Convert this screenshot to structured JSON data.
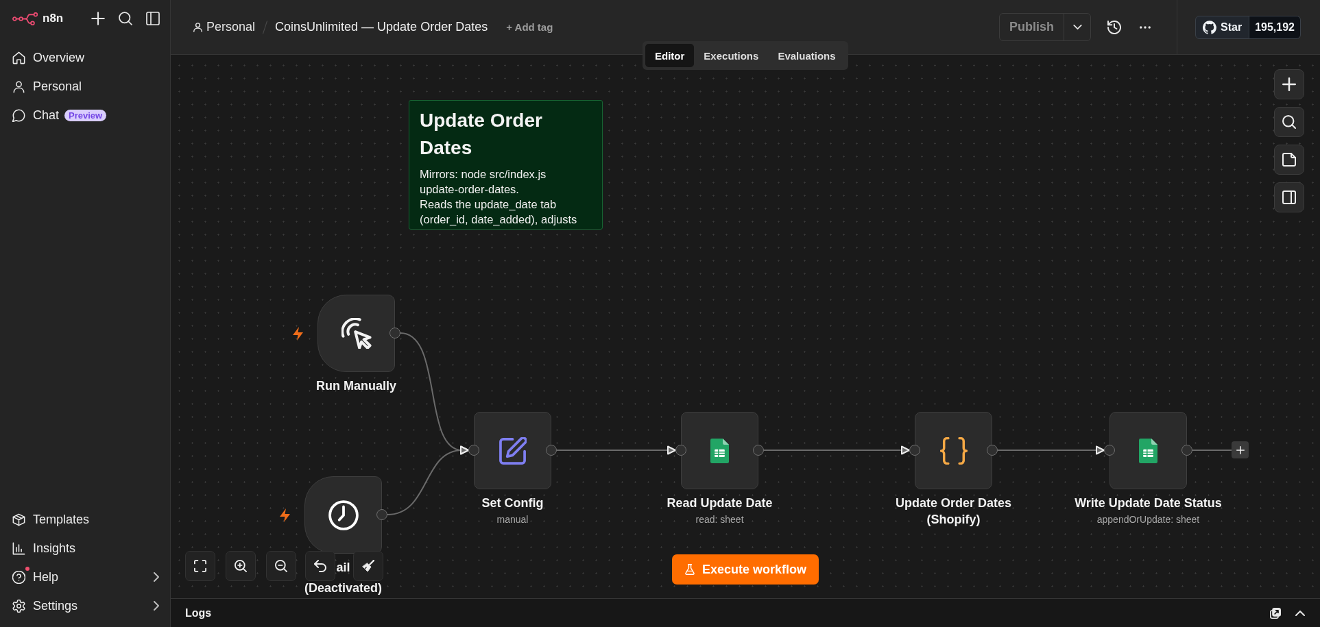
{
  "sidebar": {
    "brand": "n8n",
    "nav": [
      {
        "label": "Overview"
      },
      {
        "label": "Personal"
      },
      {
        "label": "Chat",
        "badge": "Preview"
      }
    ],
    "footer": [
      {
        "label": "Templates",
        "submenu": false,
        "notification": false
      },
      {
        "label": "Insights",
        "submenu": false,
        "notification": false
      },
      {
        "label": "Help",
        "submenu": true,
        "notification": true
      },
      {
        "label": "Settings",
        "submenu": true,
        "notification": false
      }
    ]
  },
  "header": {
    "breadcrumb": "Personal",
    "title": "CoinsUnlimited — Update Order Dates",
    "add_tag": "+ Add tag",
    "publish": {
      "label": "Publish",
      "disabled": true
    },
    "github": {
      "label": "Star",
      "count": "195,192"
    }
  },
  "tabs": [
    {
      "label": "Editor",
      "selected": true
    },
    {
      "label": "Executions",
      "selected": false
    },
    {
      "label": "Evaluations",
      "selected": false
    }
  ],
  "canvas": {
    "sticky": {
      "title": "Update Order Dates",
      "body": [
        "Mirrors: node src/index.js update-order-dates.",
        "Reads the update_date tab (order_id, date_added), adjusts"
      ]
    },
    "nodes": [
      {
        "kind": "trigger",
        "label": "Run Manually"
      },
      {
        "kind": "trigger",
        "label": "ail",
        "status": "(Deactivated)"
      },
      {
        "kind": "action",
        "label": "Set Config",
        "subtitle": "manual"
      },
      {
        "kind": "action",
        "label": "Read Update Date",
        "subtitle": "read: sheet"
      },
      {
        "kind": "action",
        "label": "Update Order Dates (Shopify)"
      },
      {
        "kind": "action",
        "label": "Write Update Date Status",
        "subtitle": "appendOrUpdate: sheet"
      }
    ],
    "execute_button": "Execute workflow"
  },
  "logs": {
    "title": "Logs"
  }
}
